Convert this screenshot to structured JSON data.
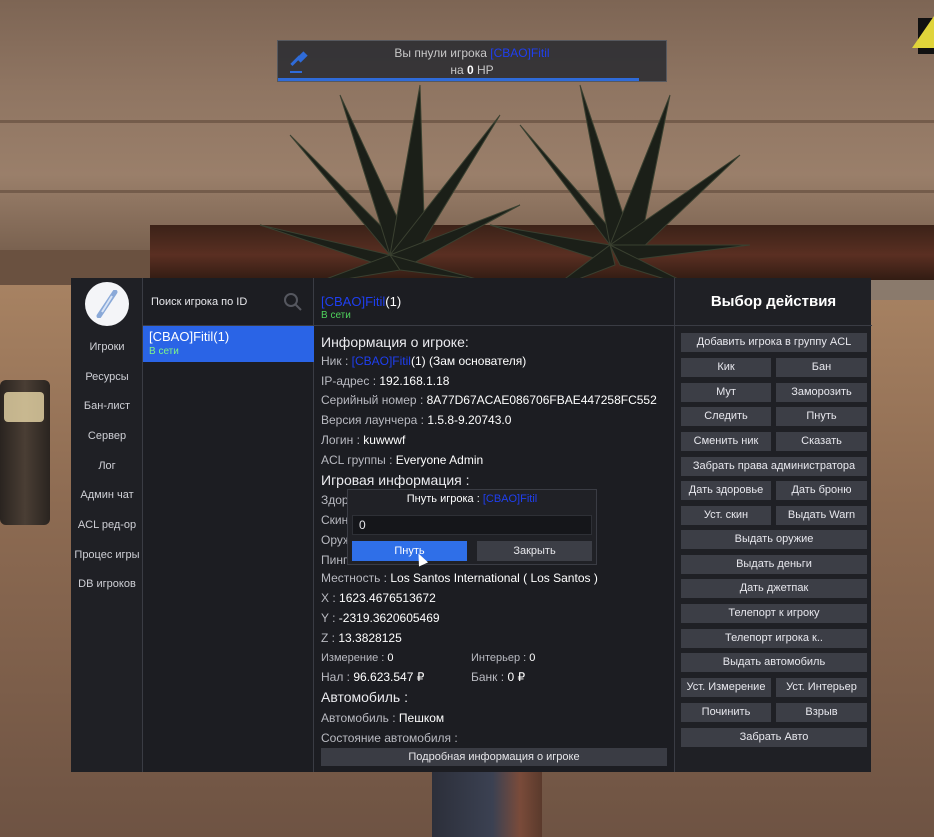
{
  "notification": {
    "prefix": "Вы пнули игрока ",
    "player": "[CBAO]Fitil",
    "line2_prefix": "на ",
    "hp_value": "0",
    "hp_suffix": " HP",
    "progress": 0.93,
    "accent": "#2f6bd8"
  },
  "nav": {
    "items": [
      "Игроки",
      "Ресурсы",
      "Бан-лист",
      "Сервер",
      "Лог",
      "Админ чат",
      "ACL ред-ор",
      "Процес игры",
      "DB игроков"
    ]
  },
  "player_list": {
    "search_label": "Поиск игрока по ID",
    "search_icon": "magnifier",
    "rows": [
      {
        "name": "[CBAO]Fitil(1)",
        "status": "В сети"
      }
    ]
  },
  "player_info": {
    "header_tag": "[CBAO]Fitil",
    "header_id": "(1)",
    "header_status": "В сети",
    "section_info": "Информация о игроке:",
    "nick_label": "Ник : ",
    "nick_tag": "[CBAO]Fitil",
    "nick_rest": "(1) (Зам основателя)",
    "ip_label": "IP-адрес : ",
    "ip_value": "192.168.1.18",
    "serial_label": "Серийный номер : ",
    "serial_value": "8A77D67ACAE086706FBAE447258FC552",
    "launcher_label": "Версия лаунчера : ",
    "launcher_value": "1.5.8-9.20743.0",
    "login_label": "Логин : ",
    "login_value": "kuwwwf",
    "acl_label": "ACL группы : ",
    "acl_value": "Everyone Admin",
    "section_game": "Игровая информация :",
    "health_label": "Здор",
    "skin_label": "Скин",
    "weapon_label": "Оруж",
    "ping_label": "Пинг",
    "location_label": "Местность : ",
    "location_value": "Los Santos International ( Los Santos )",
    "x_label": "X : ",
    "x_value": "1623.4676513672",
    "y_label": "Y : ",
    "y_value": "-2319.3620605469",
    "z_label": "Z : ",
    "z_value": "13.3828125",
    "dim_label": "Измерение : ",
    "dim_value": "0",
    "int_label": "Интерьер : ",
    "int_value": "0",
    "cash_label": "Нал : ",
    "cash_value": "96.623.547 ₽",
    "bank_label": "Банк : ",
    "bank_value": "0 ₽",
    "section_vehicle": "Автомобиль :",
    "vehicle_label": "Автомобиль : ",
    "vehicle_value": "Пешком",
    "vehicle_state_label": "Состояние автомобиля :",
    "detail_button": "Подробная информация о игроке"
  },
  "actions": {
    "title": "Выбор действия",
    "add_acl": "Добавить игрока в группу ACL",
    "kick": "Кик",
    "ban": "Бан",
    "mute": "Мут",
    "freeze": "Заморозить",
    "spectate": "Следить",
    "slap": "Пнуть",
    "change_nick": "Сменить ник",
    "say": "Сказать",
    "take_admin": "Забрать права администратора",
    "give_health": "Дать здоровье",
    "give_armor": "Дать броню",
    "set_skin": "Уст. скин",
    "give_warn": "Выдать Warn",
    "give_weapon": "Выдать оружие",
    "give_money": "Выдать деньги",
    "give_jetpack": "Дать джетпак",
    "tp_to": "Телепорт к игроку",
    "tp_player_to": "Телепорт игрока к..",
    "give_vehicle": "Выдать автомобиль",
    "set_dimension": "Уст. Измерение",
    "set_interior": "Уст. Интерьер",
    "repair": "Починить",
    "blow": "Взрыв",
    "take_vehicle": "Забрать Авто"
  },
  "dialog": {
    "title_prefix": "Пнуть игрока : ",
    "title_player": "[CBAO]Fitil",
    "input_value": "0",
    "confirm": "Пнуть",
    "close": "Закрыть"
  }
}
